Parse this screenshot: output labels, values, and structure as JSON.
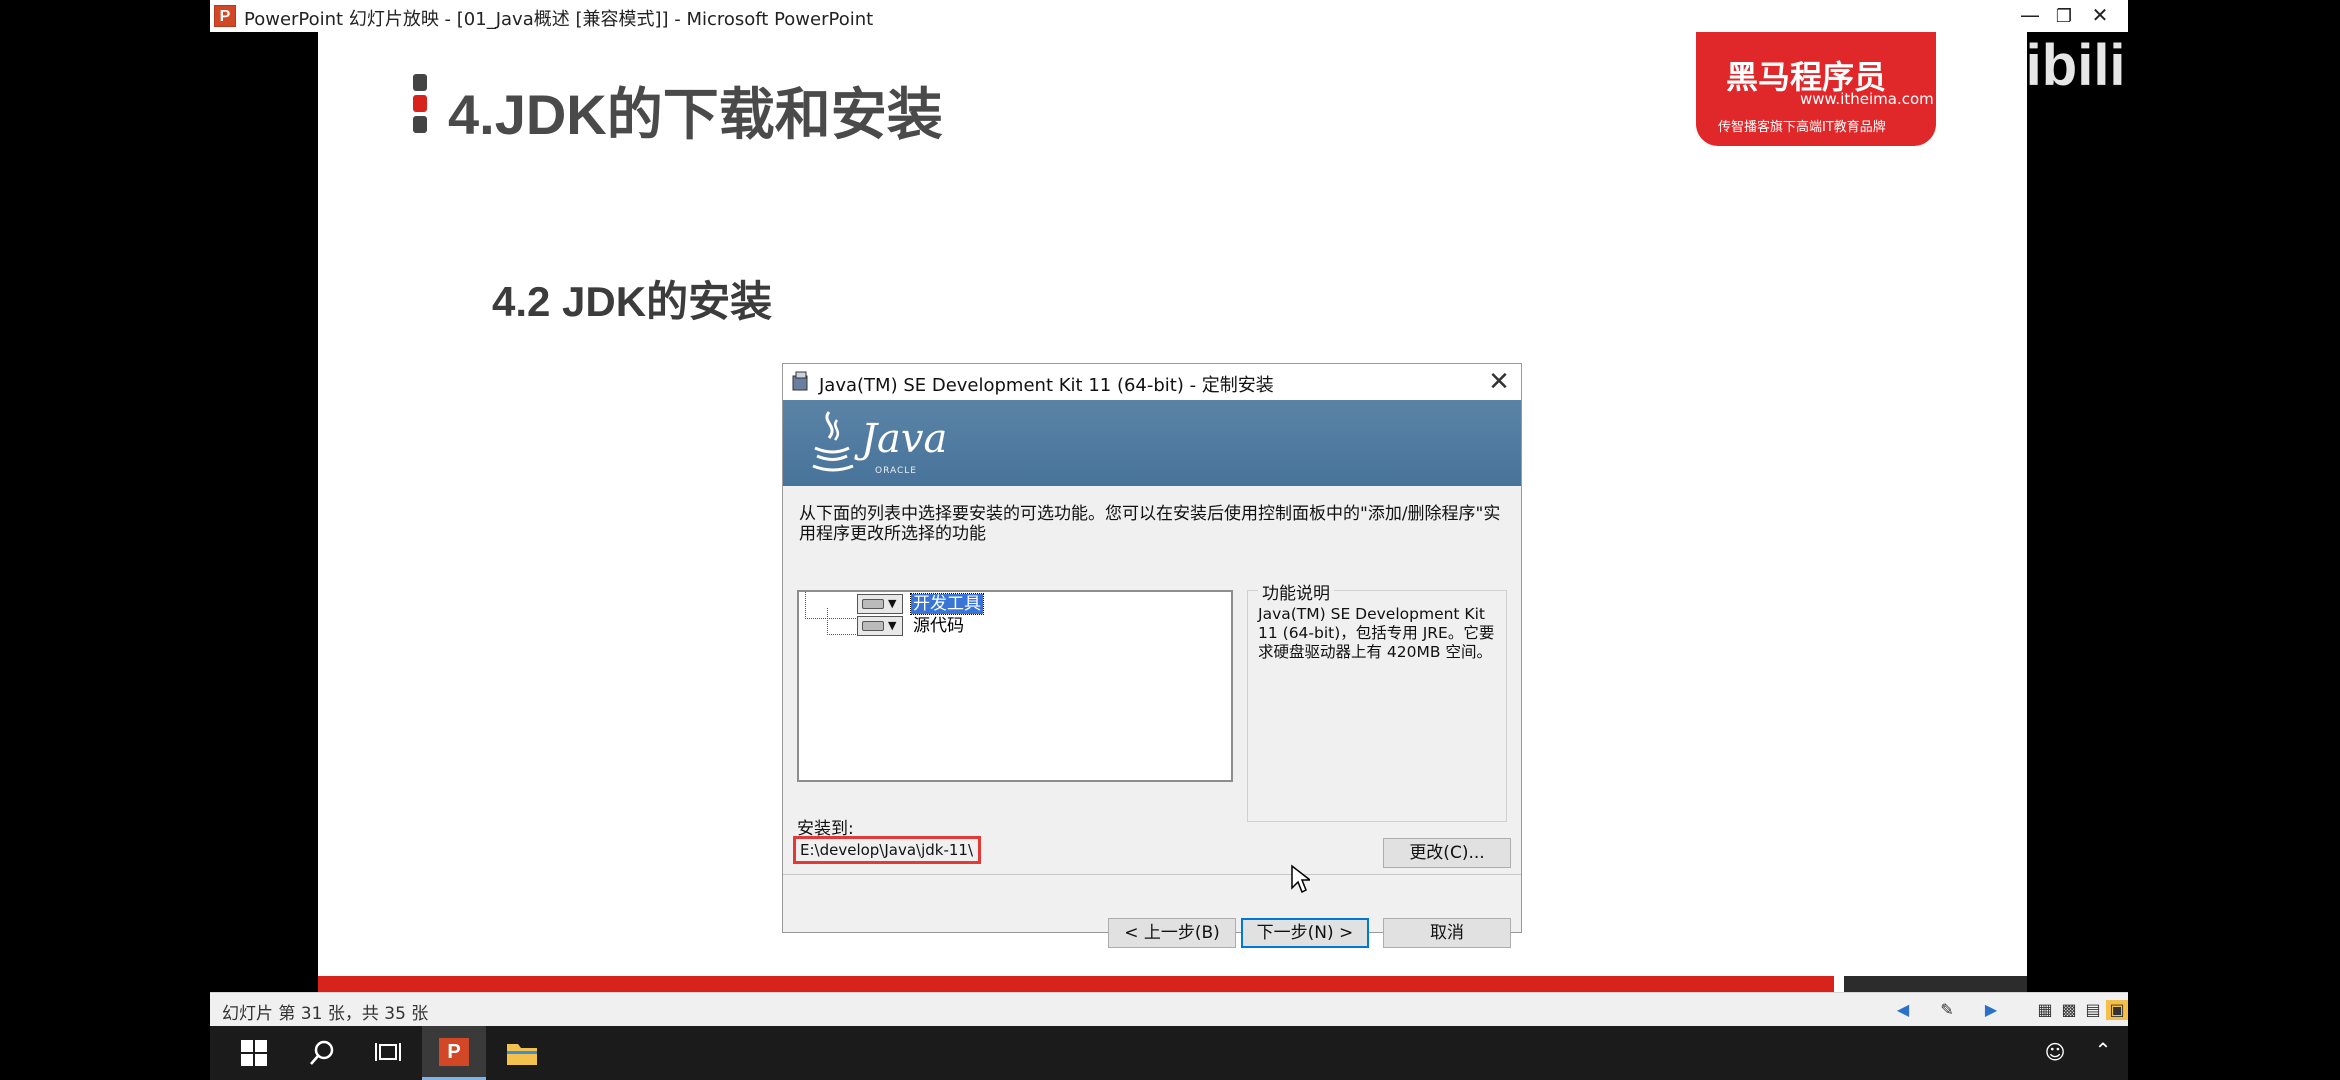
{
  "window": {
    "title": "PowerPoint 幻灯片放映 - [01_Java概述 [兼容模式]] - Microsoft PowerPoint",
    "app_icon_letter": "P",
    "minimize_icon": "minimize-icon",
    "restore_icon": "restore-icon",
    "close_icon": "close-icon"
  },
  "slide": {
    "title": "4.JDK的下载和安装",
    "subtitle": "4.2 JDK的安装",
    "logo": {
      "brand": "黑马程序员",
      "url": "www.itheima.com",
      "slogan": "传智播客旗下高端IT教育品牌"
    },
    "accent_color": "#d8231d"
  },
  "dialog": {
    "title": "Java(TM) SE Development Kit 11 (64-bit) - 定制安装",
    "banner_logo": "Java",
    "banner_sub": "ORACLE",
    "description": "从下面的列表中选择要安装的可选功能。您可以在安装后使用控制面板中的\"添加/删除程序\"实用程序更改所选择的功能",
    "features": [
      {
        "label": "开发工具",
        "selected": true
      },
      {
        "label": "源代码",
        "selected": false
      }
    ],
    "feature_desc_title": "功能说明",
    "feature_desc": "Java(TM) SE Development Kit 11 (64-bit)，包括专用 JRE。它要求硬盘驱动器上有 420MB 空间。",
    "install_to_label": "安装到:",
    "install_path": "E:\\develop\\Java\\jdk-11\\",
    "change_button": "更改(C)...",
    "back_button": "< 上一步(B)",
    "next_button": "下一步(N) >",
    "cancel_button": "取消"
  },
  "statusbar": {
    "slide_info": "幻灯片 第 31 张，共 35 张"
  },
  "watermark": "bilibili"
}
